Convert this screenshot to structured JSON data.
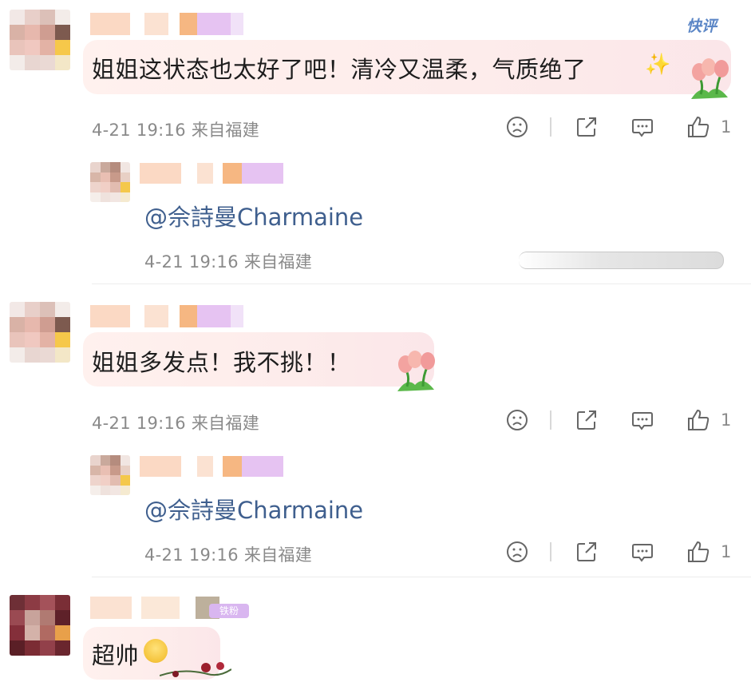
{
  "brand": {
    "label": "快评"
  },
  "colors": {
    "accent": "#3f5f8e",
    "meta": "#8a8a8a",
    "bubble": "#fdeceb"
  },
  "comments": [
    {
      "text": "姐姐这状态也太好了吧！清冷又温柔，气质绝了",
      "meta": "4-21 19:16 来自福建",
      "like_count": "1",
      "reply": {
        "mention": "@佘詩曼Charmaine",
        "meta": "4-21 19:16 来自福建"
      }
    },
    {
      "text": "姐姐多发点！我不挑！！",
      "meta": "4-21 19:16 来自福建",
      "like_count": "1",
      "reply": {
        "mention": "@佘詩曼Charmaine",
        "meta": "4-21 19:16 来自福建",
        "like_count": "1"
      }
    },
    {
      "text": "超帅",
      "badge": "铁粉"
    }
  ],
  "icons": [
    "sad-face-icon",
    "share-icon",
    "comment-icon",
    "thumbs-up-icon",
    "sparkles-icon",
    "tulip-icon"
  ]
}
